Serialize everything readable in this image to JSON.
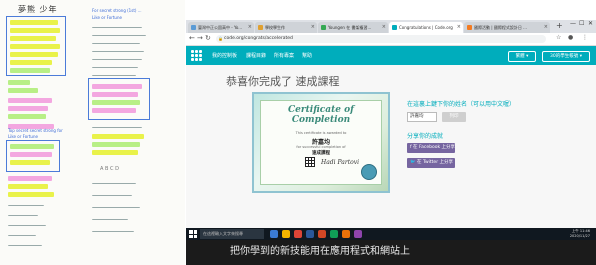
{
  "worksheet": {
    "title": "夢熊 少年",
    "note_1": "For secret strong (1st) ...",
    "note_2": "Like or Fortune",
    "note_3": "Top secret secret strong for",
    "note_4": "Like or Fortune",
    "scribble": "A  B  C  D"
  },
  "browser": {
    "tabs": [
      {
        "label": "臺灣中正公園高中 - Yo... "
      },
      {
        "label": "學校學生作"
      },
      {
        "label": "Youngen 在 書架複習..."
      },
      {
        "label": "Congratulations | Code.org"
      },
      {
        "label": "國際活動 | 國際程式設計日 ..."
      }
    ],
    "new_tab": "+",
    "url": "code.org/congrats/accelerated",
    "window_controls": [
      "—",
      "☐",
      "✕"
    ]
  },
  "site": {
    "menu": [
      "我的控制板",
      "課程目錄",
      "所有專案",
      "幫助"
    ],
    "language": "繁體",
    "account": "30的學生帳號"
  },
  "page": {
    "heading": "恭喜你完成了 速成課程",
    "print_prompt": "在這裏上鍵下你的姓名（可以用中文喔）",
    "name_value": "許嘉均",
    "print_label": "列印",
    "share_heading": "分享你的成就",
    "facebook_label": "f  在 Facebook 上分享",
    "twitter_label": "🐦 在 Twitter 上分享"
  },
  "certificate": {
    "title": "Certificate of Completion",
    "awarded_line": "This certificate is awarded to",
    "name": "許嘉均",
    "completion_line": "for successful completion of",
    "course": "速成課程",
    "signature": "Hadi Partovi"
  },
  "taskbar": {
    "search_placeholder": "在這裡輸入文字來搜尋",
    "time": "上午 11:46",
    "date": "2020/11/27"
  },
  "bottom": {
    "text": "把你學到的新技能用在應用程式和網站上"
  }
}
